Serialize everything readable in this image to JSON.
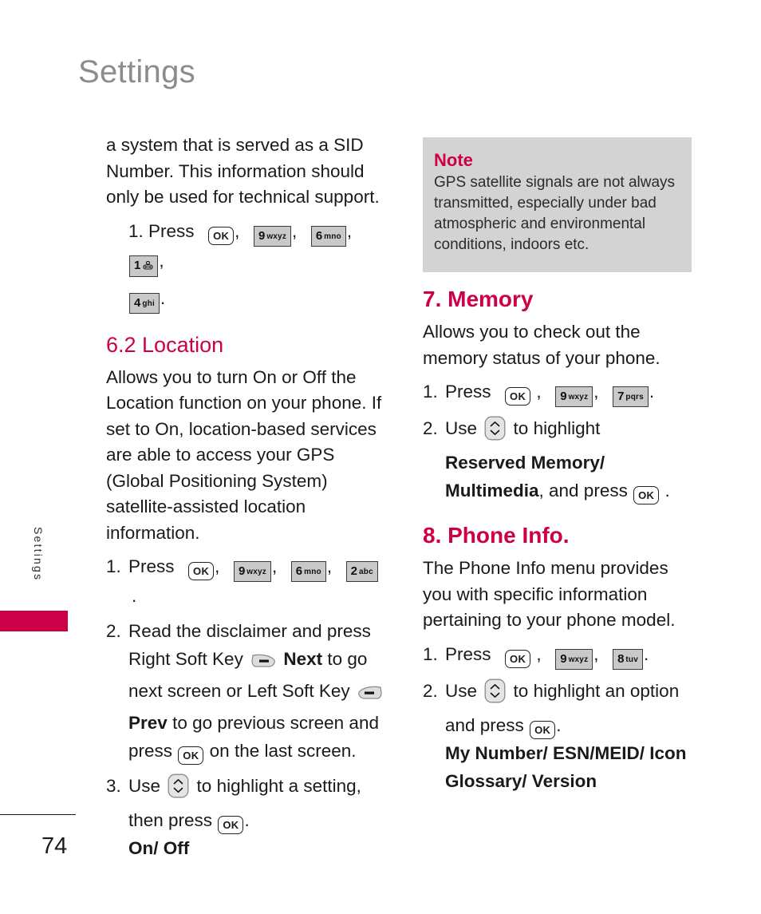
{
  "page": {
    "chapter_title": "Settings",
    "side_tab_label": "Settings",
    "page_number": "74",
    "accent_color": "#CC0049",
    "note_bg_color": "#D3D3D3",
    "title_color": "#8C8C8C"
  },
  "left_column": {
    "continued_paragraph": "a system that is served as a SID Number. This information should only be used for technical support.",
    "step_press_label": "1. Press",
    "keys_row1": [
      "OK",
      "9 wxyz",
      "6 mno",
      "1 voicemail"
    ],
    "keys_row2": [
      "4 ghi"
    ],
    "section": {
      "heading": "6.2 Location",
      "body": "Allows you to turn On or Off the Location function on your phone. If set to On, location-based services are able to access your GPS (Global Positioning System) satellite-assisted location information.",
      "steps": [
        {
          "num": "1.",
          "verb": "Press",
          "keys": [
            "OK",
            "9 wxyz",
            "6 mno",
            "2 abc"
          ],
          "trailing": "."
        },
        {
          "num": "2.",
          "text_a": "Read the disclaimer and press",
          "text_b": "Right Soft Key",
          "bold_b": "Next",
          "text_c": "to go next screen or Left Soft Key",
          "bold_c": "Prev",
          "text_d": "to go previous screen and press",
          "text_e": "on the last screen."
        },
        {
          "num": "3.",
          "text_a": "Use",
          "text_b": "to highlight a setting, then press",
          "text_c": ".",
          "options": "On/ Off"
        }
      ]
    }
  },
  "right_column": {
    "note": {
      "title": "Note",
      "body": "GPS satellite signals are not always transmitted, especially under bad atmospheric and environmental conditions, indoors etc."
    },
    "memory_section": {
      "heading": "7. Memory",
      "body": "Allows you to check out the memory status of your phone.",
      "steps": [
        {
          "num": "1.",
          "verb": "Press",
          "keys": [
            "OK",
            "9 wxyz",
            "7 pqrs"
          ],
          "trailing": "."
        },
        {
          "num": "2.",
          "text_a": "Use",
          "text_b": "to highlight",
          "bold": "Reserved Memory/ Multimedia",
          "text_c": ", and press",
          "text_d": "."
        }
      ]
    },
    "phone_info_section": {
      "heading": "8. Phone Info.",
      "body": "The Phone Info menu provides you with specific information pertaining to your phone model.",
      "steps": [
        {
          "num": "1.",
          "verb": "Press",
          "keys": [
            "OK",
            "9 wxyz",
            "8 tuv"
          ],
          "trailing": "."
        },
        {
          "num": "2.",
          "text_a": "Use",
          "text_b": "to highlight an option and press",
          "text_c": ".",
          "options": "My Number/ ESN/MEID/ Icon Glossary/ Version"
        }
      ]
    }
  },
  "keys": {
    "ok": "OK",
    "k9_digit": "9",
    "k9_sub": "wxyz",
    "k6_digit": "6",
    "k6_sub": "mno",
    "k1_digit": "1",
    "k4_digit": "4",
    "k4_sub": "ghi",
    "k2_digit": "2",
    "k2_sub": "abc",
    "k7_digit": "7",
    "k7_sub": "pqrs",
    "k8_digit": "8",
    "k8_sub": "tuv",
    "comma": ",",
    "period": "."
  }
}
